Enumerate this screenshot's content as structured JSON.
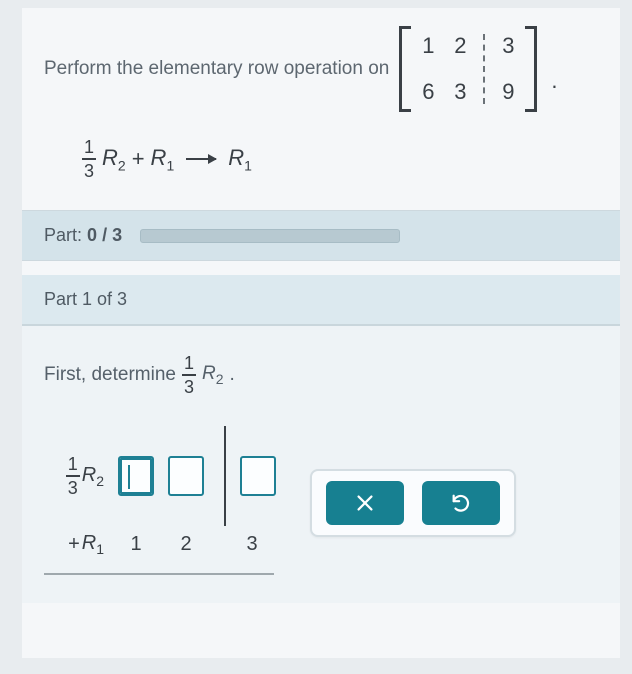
{
  "problem": {
    "prompt": "Perform the elementary row operation on",
    "matrix": {
      "rows": [
        {
          "c1": "1",
          "c2": "2",
          "aug": "3"
        },
        {
          "c1": "6",
          "c2": "3",
          "aug": "9"
        }
      ]
    },
    "period": "."
  },
  "row_operation": {
    "frac_num": "1",
    "frac_den": "3",
    "term1_base": "R",
    "term1_sub": "2",
    "plus": "+",
    "term2_base": "R",
    "term2_sub": "1",
    "result_base": "R",
    "result_sub": "1"
  },
  "progress": {
    "label_prefix": "Part:",
    "current": "0",
    "sep": "/",
    "total": "3"
  },
  "part": {
    "label": "Part 1 of 3"
  },
  "step": {
    "lead": "First, determine",
    "frac_num": "1",
    "frac_den": "3",
    "r_base": "R",
    "r_sub": "2",
    "tail": "."
  },
  "calc": {
    "row1": {
      "frac_num": "1",
      "frac_den": "3",
      "base": "R",
      "sub": "2"
    },
    "row2": {
      "plus": "+",
      "base": "R",
      "sub": "1",
      "v1": "1",
      "v2": "2",
      "v3": "3"
    }
  },
  "buttons": {
    "clear": "clear",
    "reset": "reset"
  }
}
